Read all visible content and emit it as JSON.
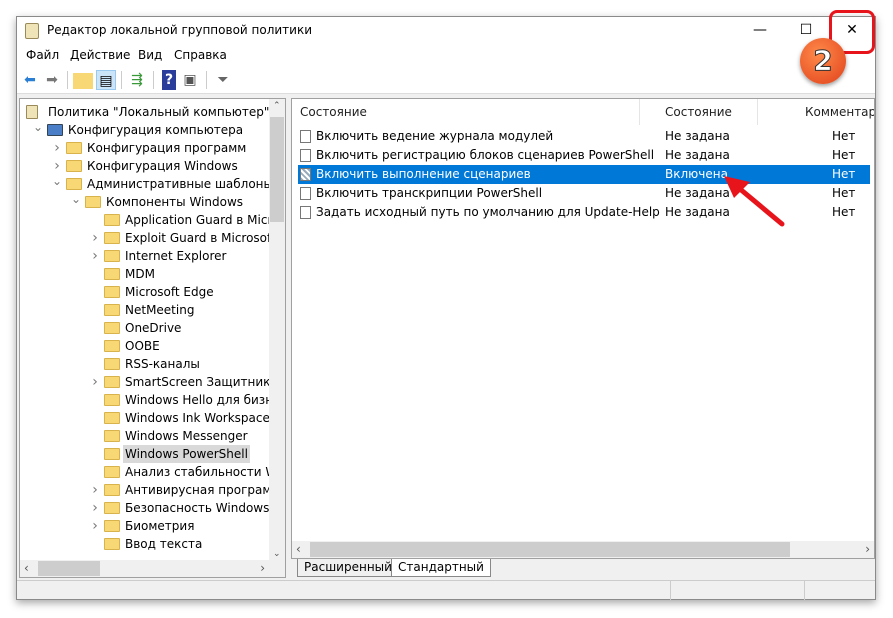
{
  "window": {
    "title": "Редактор локальной групповой политики",
    "minimize": "—",
    "maximize": "☐",
    "close": "✕"
  },
  "menu": [
    "Файл",
    "Действие",
    "Вид",
    "Справка"
  ],
  "toolbar": [
    "back-icon",
    "forward-icon",
    "up-folder-icon",
    "show-hide-tree-icon",
    "export-list-icon",
    "help-icon",
    "properties-pane-icon",
    "filter-icon"
  ],
  "tree": [
    {
      "label": "Политика \"Локальный компьютер\"",
      "level": 0,
      "chevron": "",
      "icon": "policy"
    },
    {
      "label": "Конфигурация компьютера",
      "level": 1,
      "chevron": "down",
      "icon": "computer"
    },
    {
      "label": "Конфигурация программ",
      "level": 2,
      "chevron": "right",
      "icon": "folder"
    },
    {
      "label": "Конфигурация Windows",
      "level": 2,
      "chevron": "right",
      "icon": "folder"
    },
    {
      "label": "Административные шаблоны",
      "level": 2,
      "chevron": "down",
      "icon": "folder"
    },
    {
      "label": "Компоненты Windows",
      "level": 3,
      "chevron": "down",
      "icon": "folder"
    },
    {
      "label": "Application Guard в Microsoft Defender",
      "level": 4,
      "chevron": "",
      "icon": "folder"
    },
    {
      "label": "Exploit Guard в Microsoft Defender",
      "level": 4,
      "chevron": "right",
      "icon": "folder"
    },
    {
      "label": "Internet Explorer",
      "level": 4,
      "chevron": "right",
      "icon": "folder"
    },
    {
      "label": "MDM",
      "level": 4,
      "chevron": "",
      "icon": "folder"
    },
    {
      "label": "Microsoft Edge",
      "level": 4,
      "chevron": "",
      "icon": "folder"
    },
    {
      "label": "NetMeeting",
      "level": 4,
      "chevron": "",
      "icon": "folder"
    },
    {
      "label": "OneDrive",
      "level": 4,
      "chevron": "",
      "icon": "folder"
    },
    {
      "label": "OOBE",
      "level": 4,
      "chevron": "",
      "icon": "folder"
    },
    {
      "label": "RSS-каналы",
      "level": 4,
      "chevron": "",
      "icon": "folder"
    },
    {
      "label": "SmartScreen Защитника Windows",
      "level": 4,
      "chevron": "right",
      "icon": "folder"
    },
    {
      "label": "Windows Hello для бизнеса",
      "level": 4,
      "chevron": "",
      "icon": "folder"
    },
    {
      "label": "Windows Ink Workspace",
      "level": 4,
      "chevron": "",
      "icon": "folder"
    },
    {
      "label": "Windows Messenger",
      "level": 4,
      "chevron": "",
      "icon": "folder"
    },
    {
      "label": "Windows PowerShell",
      "level": 4,
      "chevron": "",
      "icon": "folder",
      "selected": true
    },
    {
      "label": "Анализ стабильности Windows",
      "level": 4,
      "chevron": "",
      "icon": "folder"
    },
    {
      "label": "Антивирусная программа Microsoft Defender",
      "level": 4,
      "chevron": "right",
      "icon": "folder"
    },
    {
      "label": "Безопасность Windows",
      "level": 4,
      "chevron": "right",
      "icon": "folder"
    },
    {
      "label": "Биометрия",
      "level": 4,
      "chevron": "right",
      "icon": "folder"
    },
    {
      "label": "Ввод текста",
      "level": 4,
      "chevron": "",
      "icon": "folder"
    }
  ],
  "list": {
    "columns": [
      "Состояние",
      "Состояние",
      "Комментарий"
    ],
    "rows": [
      {
        "name": "Включить ведение журнала модулей",
        "state": "Не задана",
        "comment": "Нет"
      },
      {
        "name": "Включить регистрацию блоков сценариев PowerShell",
        "state": "Не задана",
        "comment": "Нет"
      },
      {
        "name": "Включить выполнение сценариев",
        "state": "Включена",
        "comment": "Нет",
        "selected": true
      },
      {
        "name": "Включить транскрипции PowerShell",
        "state": "Не задана",
        "comment": "Нет"
      },
      {
        "name": "Задать исходный путь по умолчанию для Update-Help",
        "state": "Не задана",
        "comment": "Нет"
      }
    ]
  },
  "tabs": [
    "Расширенный",
    "Стандартный"
  ],
  "annotation": {
    "step": "2",
    "color": "#e8141b"
  }
}
